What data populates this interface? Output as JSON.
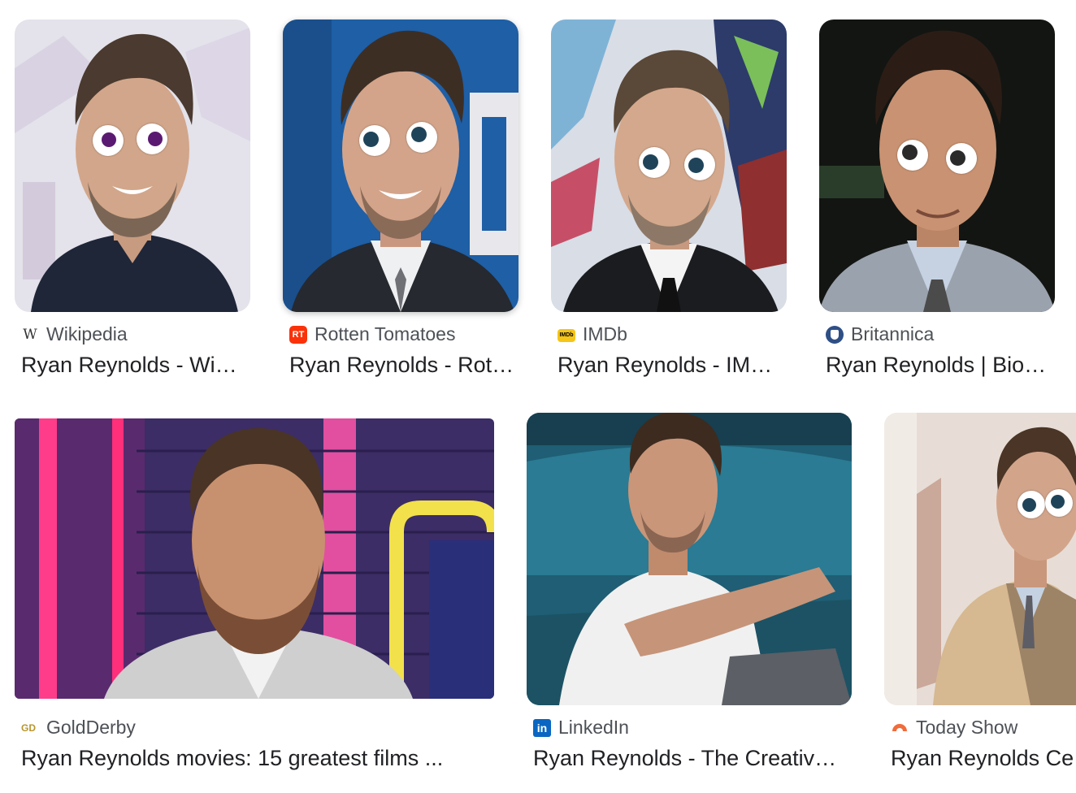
{
  "results": [
    {
      "source": "Wikipedia",
      "title": "Ryan Reynolds - Wi…",
      "favicon": "wikipedia-icon",
      "eye_color": "#5b1a72"
    },
    {
      "source": "Rotten Tomatoes",
      "title": "Ryan Reynolds - Rot…",
      "favicon": "rotten-tomatoes-icon",
      "eye_color": "#1f4459"
    },
    {
      "source": "IMDb",
      "title": "Ryan Reynolds - IM…",
      "favicon": "imdb-icon",
      "eye_color": "#1f4459"
    },
    {
      "source": "Britannica",
      "title": "Ryan Reynolds | Bio…",
      "favicon": "britannica-icon",
      "eye_color": "#2a2a2a"
    },
    {
      "source": "GoldDerby",
      "title": "Ryan Reynolds movies: 15 greatest films ...",
      "favicon": "goldderby-icon"
    },
    {
      "source": "LinkedIn",
      "title": "Ryan Reynolds - The Creativ…",
      "favicon": "linkedin-icon"
    },
    {
      "source": "Today Show",
      "title": "Ryan Reynolds Ce",
      "favicon": "today-show-icon",
      "eye_color": "#1f4459"
    }
  ],
  "colors": {
    "source_text": "#4d5156",
    "title_text": "#202124",
    "rotten_tomatoes": "#fa320a",
    "imdb": "#f5c518",
    "britannica": "#2e4f86",
    "linkedin": "#0a66c2",
    "today_show": "#f26b3a"
  }
}
